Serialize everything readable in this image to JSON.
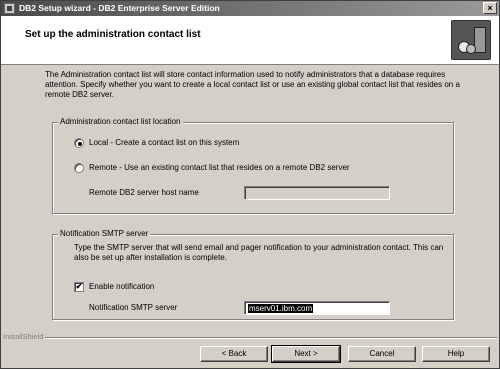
{
  "window": {
    "title": "DB2 Setup wizard - DB2 Enterprise Server Edition",
    "close_label": "×"
  },
  "header": {
    "title": "Set up the administration contact list"
  },
  "intro": "The Administration contact list will store contact information used to notify administrators that a database requires attention. Specify whether you want to create a local contact list or use an existing global contact list that resides on a remote DB2 server.",
  "location_group": {
    "legend": "Administration contact list location",
    "options": [
      {
        "label": "Local - Create a contact list on this system",
        "checked": true
      },
      {
        "label": "Remote - Use an existing contact list that resides on a remote DB2 server",
        "checked": false
      }
    ],
    "remote_host_label": "Remote DB2 server host name",
    "remote_host_value": ""
  },
  "smtp_group": {
    "legend": "Notification SMTP server",
    "description": "Type the SMTP server that will send email and pager notification to your administration contact. This can also be set up after installation is complete.",
    "enable_label": "Enable notification",
    "enable_checked": true,
    "enable_mark": "✔",
    "server_label": "Notification SMTP server",
    "server_value": "mserv01.ibm.com"
  },
  "footer": {
    "brand": "InstallShield",
    "buttons": {
      "back": "< Back",
      "next": "Next >",
      "cancel": "Cancel",
      "help": "Help"
    }
  }
}
